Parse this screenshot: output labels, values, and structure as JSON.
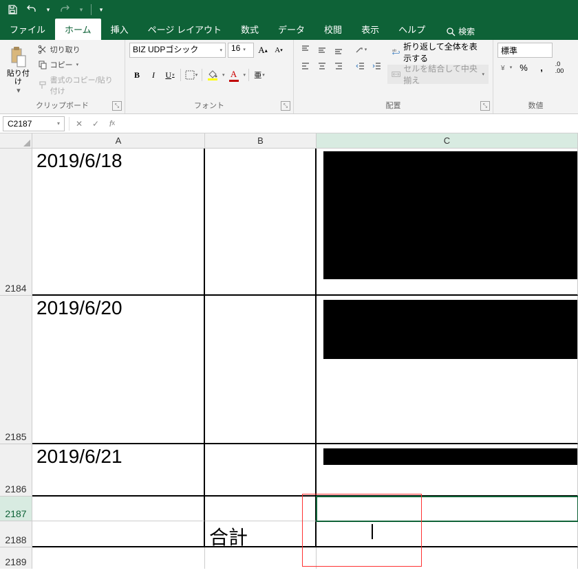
{
  "qat": {
    "save": "保存",
    "undo": "元に戻す",
    "redo": "やり直し"
  },
  "tabs": {
    "file": "ファイル",
    "home": "ホーム",
    "insert": "挿入",
    "pagelayout": "ページ レイアウト",
    "formulas": "数式",
    "data": "データ",
    "review": "校閲",
    "view": "表示",
    "help": "ヘルプ"
  },
  "search_placeholder": "検索",
  "ribbon": {
    "clipboard": {
      "paste": "貼り付け",
      "cut": "切り取り",
      "copy": "コピー",
      "format_painter": "書式のコピー/貼り付け",
      "label": "クリップボード"
    },
    "font": {
      "name": "BIZ UDPゴシック",
      "size": "16",
      "label": "フォント"
    },
    "alignment": {
      "wrap": "折り返して全体を表示する",
      "merge": "セルを結合して中央揃え",
      "label": "配置"
    },
    "number": {
      "format": "標準",
      "label": "数値"
    }
  },
  "namebox": "C2187",
  "columns": {
    "A": "A",
    "B": "B",
    "C": "C"
  },
  "rows": {
    "r2184": "2184",
    "r2185": "2185",
    "r2186": "2186",
    "r2187": "2187",
    "r2188": "2188",
    "r2189": "2189"
  },
  "cells": {
    "A2184": "2019/6/18",
    "A2185": "2019/6/20",
    "A2186": "2019/6/21",
    "B2188": "合計"
  }
}
